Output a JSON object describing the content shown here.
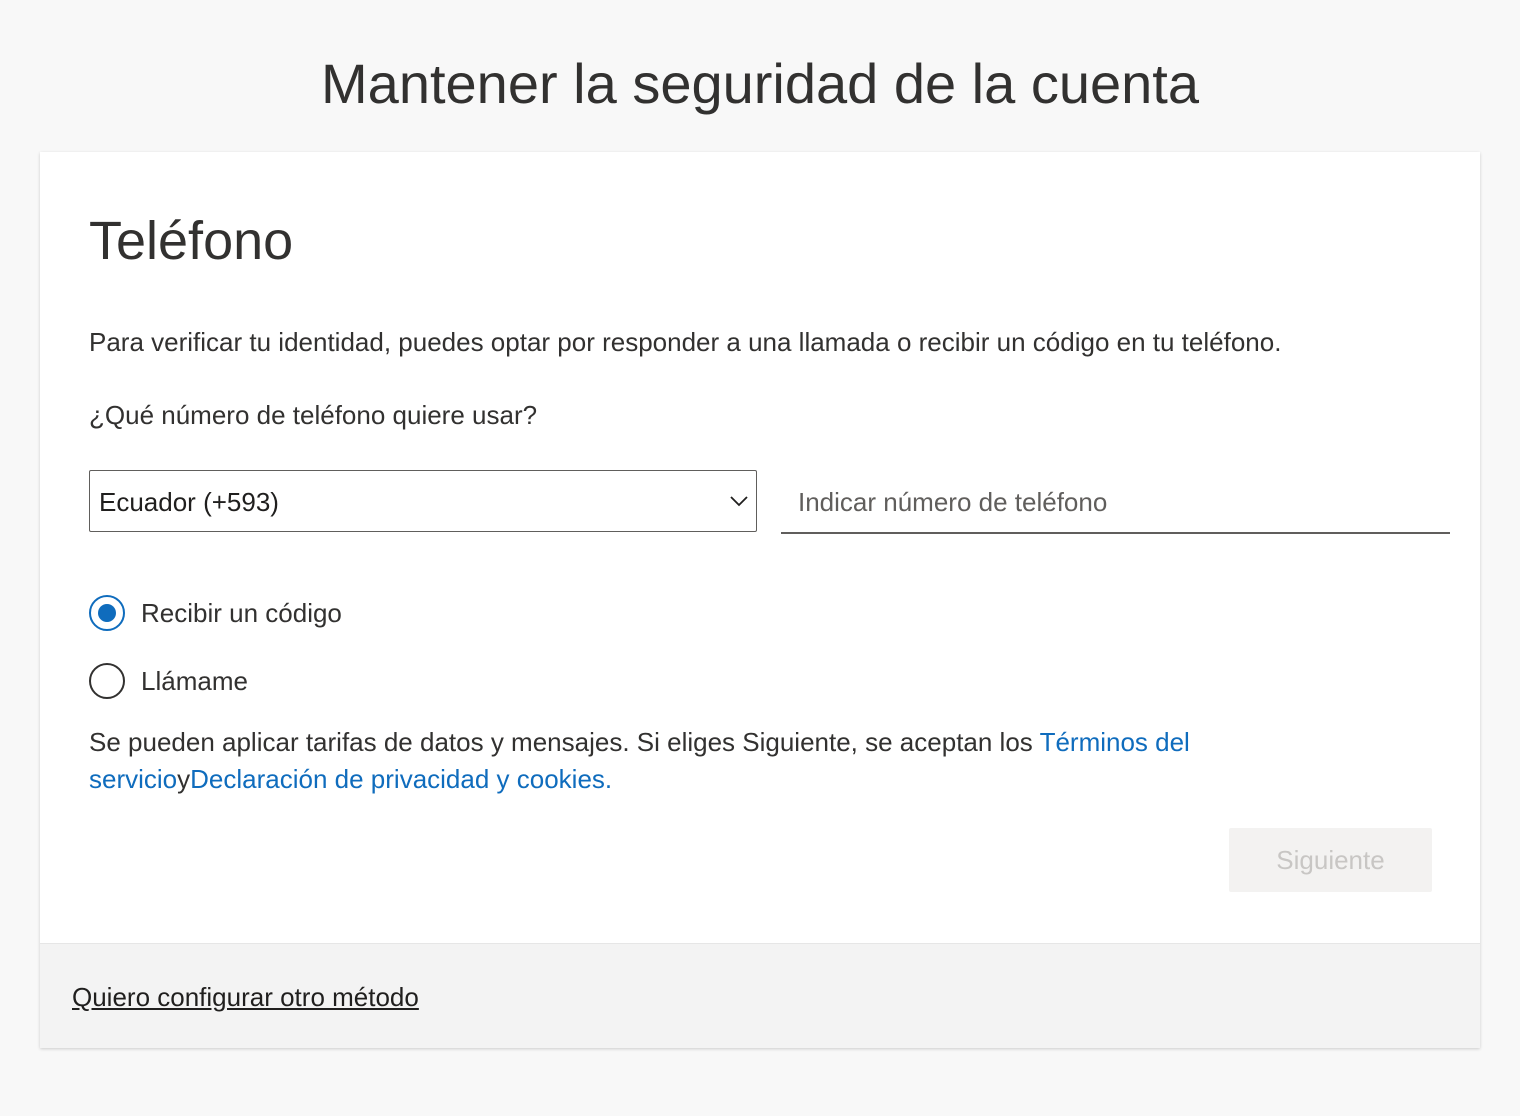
{
  "page": {
    "title": "Mantener la seguridad de la cuenta"
  },
  "section": {
    "title": "Teléfono",
    "description": "Para verificar tu identidad, puedes optar por responder a una llamada o recibir un código en tu teléfono.",
    "question": "¿Qué número de teléfono quiere usar?"
  },
  "country_select": {
    "selected": "Ecuador (+593)",
    "icon": "chevron-down-icon"
  },
  "phone_input": {
    "value": "",
    "placeholder": "Indicar número de teléfono"
  },
  "method_options": [
    {
      "label": "Recibir un código",
      "selected": true
    },
    {
      "label": "Llámame",
      "selected": false
    }
  ],
  "terms": {
    "text_before": "Se pueden aplicar tarifas de datos y mensajes. Si eliges Siguiente, se aceptan los ",
    "terms_link": "Términos del servicio",
    "conjunction": "y",
    "privacy_link": "Declaración de privacidad y cookies."
  },
  "actions": {
    "next_label": "Siguiente",
    "next_enabled": false
  },
  "footer": {
    "other_method_link": "Quiero configurar otro método"
  },
  "colors": {
    "accent": "#0f6cbd",
    "text": "#323130",
    "page_background": "#f8f8f8",
    "footer_background": "#f3f3f3",
    "disabled_button": "#f3f2f1",
    "disabled_text": "#c8c6c4"
  }
}
